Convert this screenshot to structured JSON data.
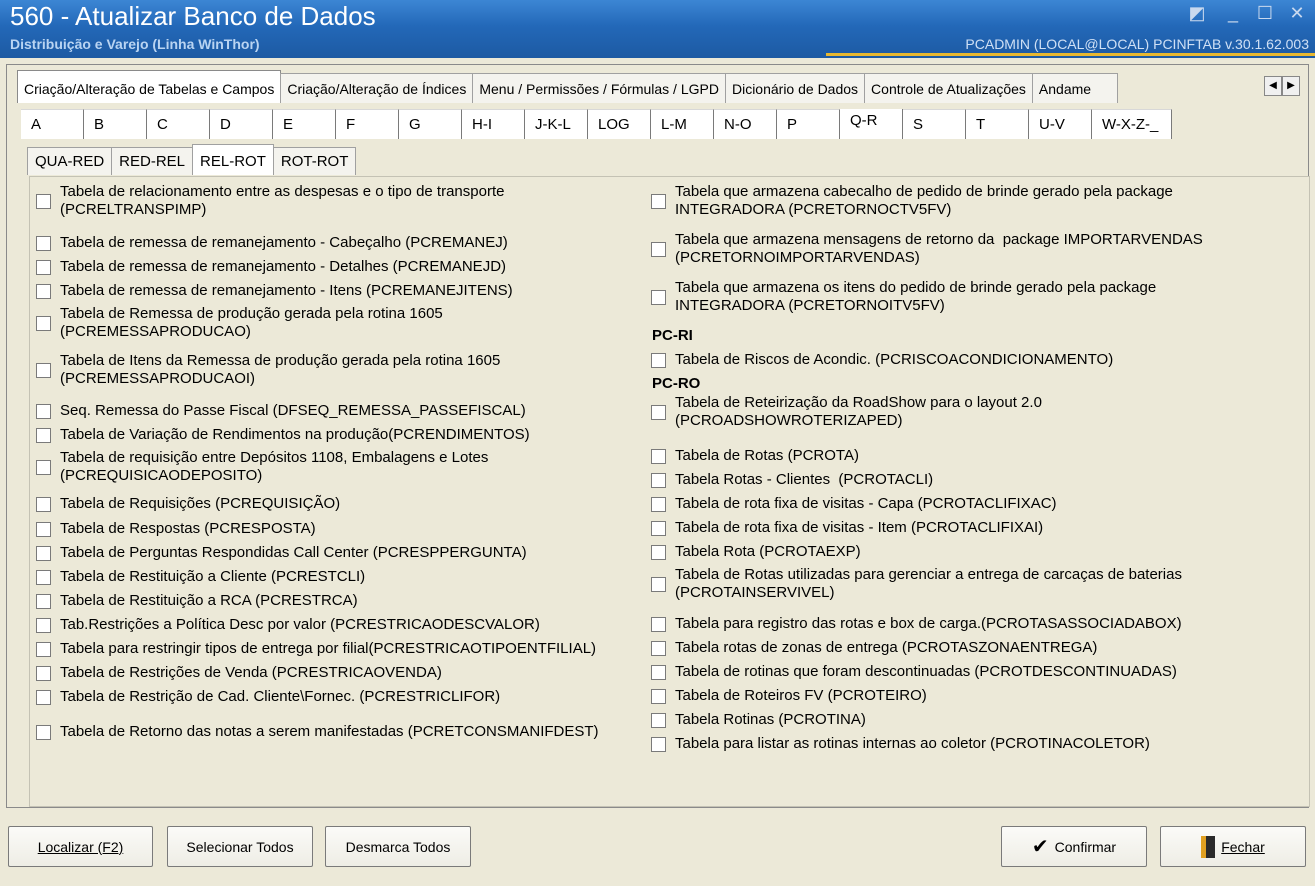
{
  "window": {
    "title": "560 - Atualizar Banco de Dados",
    "subtitle": "Distribuição e Varejo (Linha WinThor)",
    "info": "PCADMIN (LOCAL@LOCAL)  PCINFTAB  v.30.1.62.003"
  },
  "main_tabs": [
    "Criação/Alteração de Tabelas e Campos",
    "Criação/Alteração de Índices",
    "Menu / Permissões / Fórmulas / LGPD",
    "Dicionário de Dados",
    "Controle de Atualizações",
    "Andame"
  ],
  "letter_tabs": [
    "A",
    "B",
    "C",
    "D",
    "E",
    "F",
    "G",
    "H-I",
    "J-K-L",
    "LOG",
    "L-M",
    "N-O",
    "P",
    "Q-R",
    "S",
    "T",
    "U-V",
    "W-X-Z-_"
  ],
  "active_letter_tab": "Q-R",
  "sub_tabs": [
    "QUA-RED",
    "RED-REL",
    "REL-ROT",
    "ROT-ROT"
  ],
  "active_sub_tab": "REL-ROT",
  "left_items": [
    "Tabela de relacionamento entre as despesas e o tipo de transporte\n(PCRELTRANSPIMP)",
    "Tabela de remessa de remanejamento - Cabeçalho (PCREMANEJ)",
    "Tabela de remessa de remanejamento - Detalhes (PCREMANEJD)",
    "Tabela de remessa de remanejamento - Itens (PCREMANEJITENS)",
    "Tabela de Remessa de produção gerada pela rotina 1605\n(PCREMESSAPRODUCAO)",
    "Tabela de Itens da Remessa de produção gerada pela rotina 1605\n(PCREMESSAPRODUCAOI)",
    "Seq. Remessa do Passe Fiscal (DFSEQ_REMESSA_PASSEFISCAL)",
    "Tabela de Variação de Rendimentos na produção(PCRENDIMENTOS)",
    "Tabela de requisição entre Depósitos 1108, Embalagens e Lotes\n(PCREQUISICAODEPOSITO)",
    "Tabela de Requisições (PCREQUISIÇÃO)",
    "Tabela de Respostas (PCRESPOSTA)",
    "Tabela de Perguntas Respondidas Call Center (PCRESPPERGUNTA)",
    "Tabela de Restituição a Cliente (PCRESTCLI)",
    "Tabela de Restituição a RCA (PCRESTRCA)",
    "Tab.Restrições a Política Desc por valor (PCRESTRICAODESCVALOR)",
    "Tabela para restringir tipos de entrega por filial(PCRESTRICAOTIPOENTFILIAL)",
    "Tabela de Restrições de Venda (PCRESTRICAOVENDA)",
    "Tabela de Restrição de Cad. Cliente\\Fornec. (PCRESTRICLIFOR)",
    "Tabela de Retorno das notas a serem manifestadas (PCRETCONSMANIFDEST)"
  ],
  "right_items": [
    "Tabela que armazena cabecalho de pedido de brinde gerado pela package\nINTEGRADORA (PCRETORNOCTV5FV)",
    "Tabela que armazena mensagens de retorno da  package IMPORTARVENDAS\n(PCRETORNOIMPORTARVENDAS)",
    "Tabela que armazena os itens do pedido de brinde gerado pela package\nINTEGRADORA (PCRETORNOITV5FV)",
    "Tabela de Riscos de Acondic. (PCRISCOACONDICIONAMENTO)",
    "Tabela de Reteirização da RoadShow para o layout 2.0\n(PCROADSHOWROTERIZAPED)",
    "Tabela de Rotas (PCROTA)",
    "Tabela Rotas - Clientes  (PCROTACLI)",
    "Tabela de rota fixa de visitas - Capa (PCROTACLIFIXAC)",
    "Tabela de rota fixa de visitas - Item (PCROTACLIFIXAI)",
    "Tabela Rota (PCROTAEXP)",
    "Tabela de Rotas utilizadas para gerenciar a entrega de carcaças de baterias\n(PCROTAINSERVIVEL)",
    "Tabela para registro das rotas e box de carga.(PCROTASASSOCIADABOX)",
    "Tabela rotas de zonas de entrega (PCROTASZONAENTREGA)",
    "Tabela de rotinas que foram descontinuadas (PCROTDESCONTINUADAS)",
    "Tabela de Roteiros FV (PCROTEIRO)",
    "Tabela Rotinas (PCROTINA)",
    "Tabela para listar as rotinas internas ao coletor (PCROTINACOLETOR)"
  ],
  "sections": [
    "PC-RI",
    "PC-RO"
  ],
  "buttons": {
    "localizar": "Localizar (F2)",
    "selecionar": "Selecionar Todos",
    "desmarca": "Desmarca Todos",
    "confirmar": "Confirmar",
    "fechar": "Fechar"
  },
  "colors": {
    "titlebar": "#2368b8",
    "accent_line": "#e8b830",
    "confirm_check": "#000000"
  }
}
